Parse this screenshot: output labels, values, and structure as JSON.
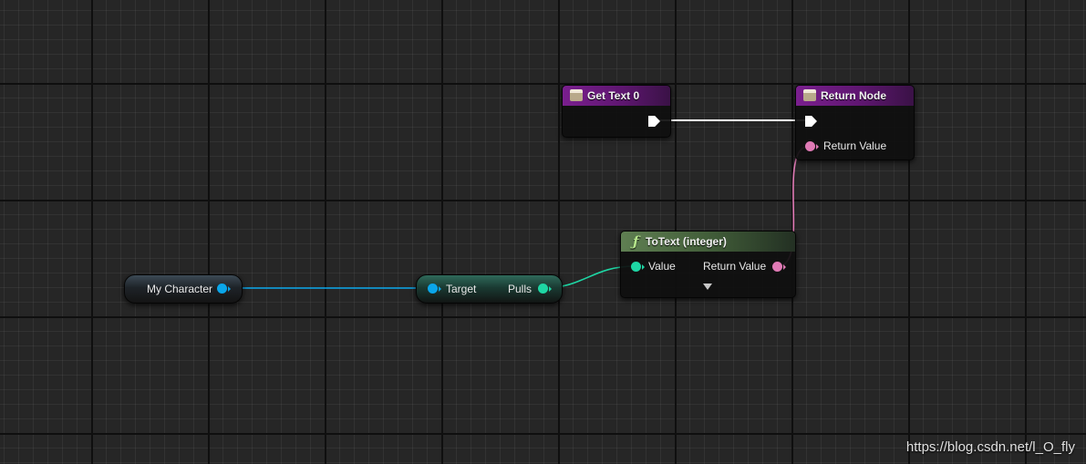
{
  "graph": {
    "nodes": {
      "get_text": {
        "title": "Get Text 0"
      },
      "return_node": {
        "title": "Return Node",
        "pin_label": "Return Value"
      },
      "to_text": {
        "title": "ToText (integer)",
        "input_label": "Value",
        "output_label": "Return Value"
      },
      "my_character": {
        "label": "My Character"
      },
      "pulls": {
        "input_label": "Target",
        "output_label": "Pulls"
      }
    }
  },
  "colors": {
    "exec": "#ffffff",
    "object_pin": "#0aa6ea",
    "integer_pin": "#1ed6a4",
    "text_pin": "#e07ab5"
  },
  "watermark": "https://blog.csdn.net/l_O_fly"
}
